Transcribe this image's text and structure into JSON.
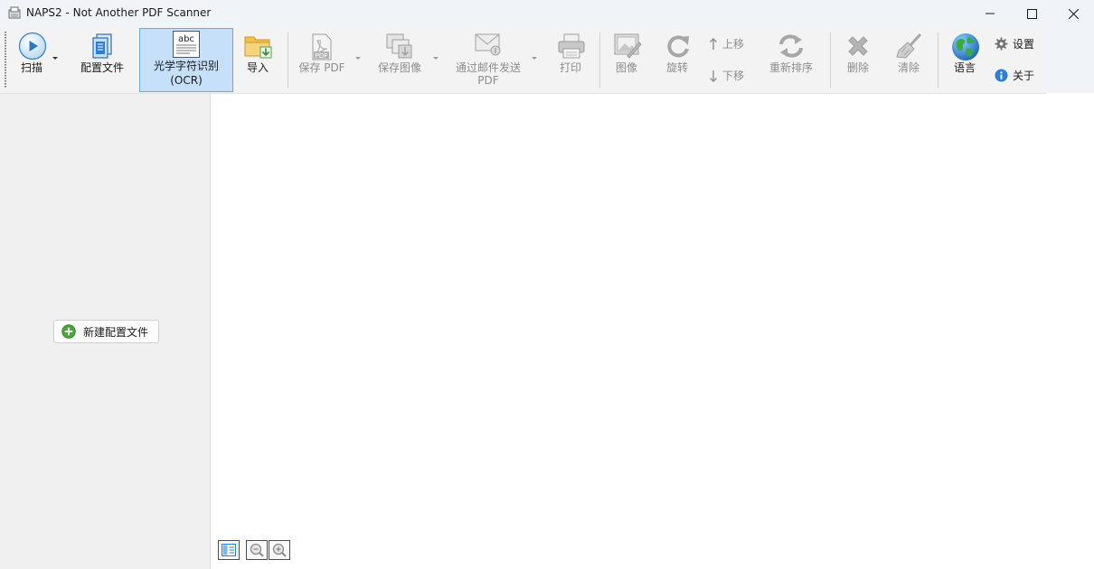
{
  "window": {
    "title": "NAPS2 - Not Another PDF Scanner"
  },
  "toolbar": {
    "scan_label": "扫描",
    "profiles_label": "配置文件",
    "ocr_label_line1": "光学字符识别",
    "ocr_label_line2": "(OCR)",
    "import_label": "导入",
    "save_pdf_label": "保存 PDF",
    "save_images_label": "保存图像",
    "email_pdf_line1": "通过邮件发送",
    "email_pdf_line2": "PDF",
    "print_label": "打印",
    "image_label": "图像",
    "rotate_label": "旋转",
    "move_up_label": "上移",
    "move_down_label": "下移",
    "reorder_label": "重新排序",
    "delete_label": "删除",
    "clear_label": "清除",
    "language_label": "语言",
    "settings_label": "设置",
    "about_label": "关于",
    "pdf_icon_text": "PDF",
    "ocr_icon_text": "abc"
  },
  "left_panel": {
    "new_profile_label": "新建配置文件"
  },
  "colors": {
    "accent_blue": "#2b7fd6",
    "ocr_active_bg": "#c5e0f8",
    "panel_bg": "#f0f0f0",
    "toolbar_bg": "#f3f3f3"
  },
  "icons": [
    "app-icon",
    "minimize-icon",
    "maximize-icon",
    "close-icon",
    "scan-play-icon",
    "profiles-icon",
    "ocr-icon",
    "import-folder-icon",
    "save-pdf-icon",
    "save-images-icon",
    "email-icon",
    "printer-icon",
    "image-edit-icon",
    "rotate-icon",
    "arrow-up-icon",
    "arrow-down-icon",
    "reorder-icon",
    "delete-x-icon",
    "broom-icon",
    "globe-icon",
    "gear-icon",
    "info-icon",
    "plus-circle-icon",
    "toggle-view-icon",
    "zoom-out-icon",
    "zoom-in-icon"
  ]
}
